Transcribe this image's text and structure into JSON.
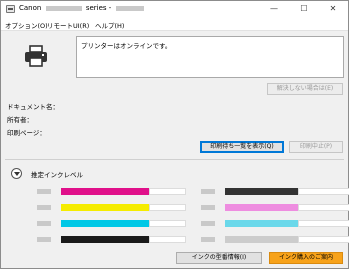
{
  "window": {
    "title_brand": "Canon",
    "title_model": "series -",
    "controls": {
      "minimize": "—",
      "maximize": "☐",
      "close": "✕"
    }
  },
  "menu": [
    {
      "label": "オプション(O)"
    },
    {
      "label": "リモートUI(R)"
    },
    {
      "label": "ヘルプ(H)"
    }
  ],
  "status_message": "プリンターはオンラインです。",
  "buttons": {
    "resolve": "解決しない場合は(E)",
    "show_queue": "印刷待ち一覧を表示(Q)",
    "cancel_print": "印刷中止(P)",
    "ink_model_info": "インクの型番情報(I)",
    "buy_ink": "インク購入のご案内"
  },
  "fields": {
    "document_name": "ドキュメント名：",
    "owner": "所有者：",
    "printing_page": "印刷ページ："
  },
  "ink_section": {
    "heading": "推定インクレベル",
    "left_column": [
      {
        "color": "#e0108a",
        "level": 0.7
      },
      {
        "color": "#f5ec00",
        "level": 0.7
      },
      {
        "color": "#00c8e6",
        "level": 0.7
      },
      {
        "color": "#1a1a1a",
        "level": 0.7
      }
    ],
    "right_column": [
      {
        "color": "#333333",
        "level": 0.58
      },
      {
        "color": "#ee8de0",
        "level": 0.58
      },
      {
        "color": "#6ad8ea",
        "level": 0.58
      },
      {
        "color": "#cccccc",
        "level": 0.58
      }
    ],
    "accent_button_color": "#f7a21a"
  }
}
